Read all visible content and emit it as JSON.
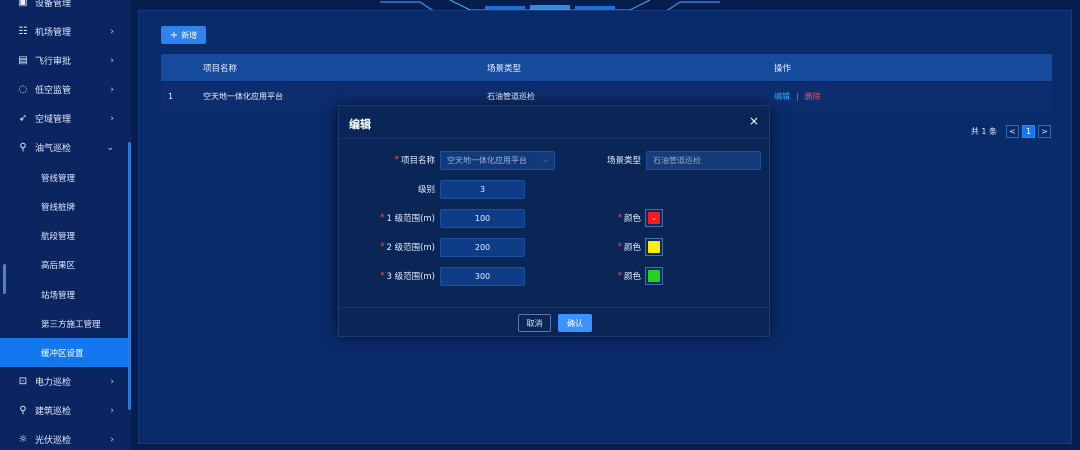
{
  "sidebar": {
    "items": [
      {
        "label": "设备管理",
        "icon": "device-icon"
      },
      {
        "label": "机场管理",
        "icon": "airport-icon"
      },
      {
        "label": "飞行审批",
        "icon": "approval-icon"
      },
      {
        "label": "低空监管",
        "icon": "monitor-icon"
      },
      {
        "label": "空域管理",
        "icon": "airspace-icon"
      },
      {
        "label": "油气巡检",
        "icon": "pipeline-icon"
      },
      {
        "label": "电力巡检",
        "icon": "power-icon"
      },
      {
        "label": "建筑巡检",
        "icon": "building-icon"
      },
      {
        "label": "光伏巡检",
        "icon": "solar-icon"
      }
    ],
    "sub_items": [
      "管线管理",
      "管线桩牌",
      "航段管理",
      "高后果区",
      "站场管理",
      "第三方施工管理",
      "缓冲区设置"
    ],
    "active_sub": "缓冲区设置"
  },
  "toolbar": {
    "add_label": "新增"
  },
  "table": {
    "headers": [
      "项目名称",
      "场景类型",
      "操作"
    ],
    "rows": [
      {
        "index": "1",
        "name": "空天地一体化应用平台",
        "scene": "石油管道巡检",
        "edit": "编辑",
        "delete": "删除"
      }
    ]
  },
  "pagination": {
    "total_label": "共 1 条",
    "prev": "<",
    "current": "1",
    "next": ">"
  },
  "modal": {
    "title": "编辑",
    "close": "×",
    "project_label": "项目名称",
    "project_value": "空天地一体化应用平台",
    "scene_label": "场景类型",
    "scene_value": "石油管道巡检",
    "level_label": "级别",
    "level_value": "3",
    "ranges": [
      {
        "label": "1 级范围(m)",
        "value": "100",
        "color_label": "颜色",
        "color": "#ff1a1a"
      },
      {
        "label": "2 级范围(m)",
        "value": "200",
        "color_label": "颜色",
        "color": "#ffee00"
      },
      {
        "label": "3 级范围(m)",
        "value": "300",
        "color_label": "颜色",
        "color": "#1ed41e"
      }
    ],
    "cancel_label": "取消",
    "confirm_label": "确认"
  }
}
